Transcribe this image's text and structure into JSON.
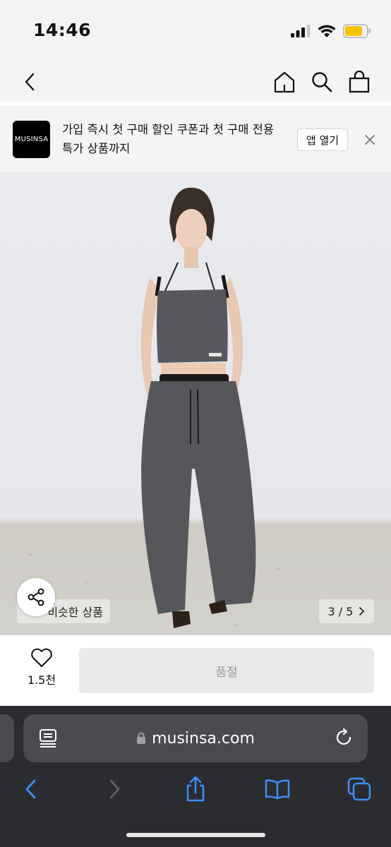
{
  "status_bar": {
    "time": "14:46",
    "icons": [
      "cellular-signal-icon",
      "wifi-icon",
      "battery-icon"
    ],
    "battery_color": "#f5c400"
  },
  "nav": {
    "icons": [
      "back-chevron-icon",
      "home-icon",
      "search-icon",
      "shopping-bag-icon"
    ]
  },
  "banner": {
    "logo_text": "MUSINSA",
    "text": "가입 즉시 첫 구매 할인 쿠폰과 첫 구매 전용 특가 상품까지",
    "app_button": "앱 열기",
    "close_icon": "close-icon"
  },
  "product": {
    "similar_label": "비슷한 상품",
    "pager_text": "3 / 5",
    "share_icon": "share-icon",
    "like_count": "1.5천",
    "soldout_label": "품절"
  },
  "browser": {
    "url": "musinsa.com",
    "icons": [
      "reader-icon",
      "lock-icon",
      "reload-icon",
      "back-icon",
      "forward-icon",
      "share-icon",
      "bookmarks-icon",
      "tabs-icon"
    ],
    "accent_color": "#3d8ff6"
  }
}
